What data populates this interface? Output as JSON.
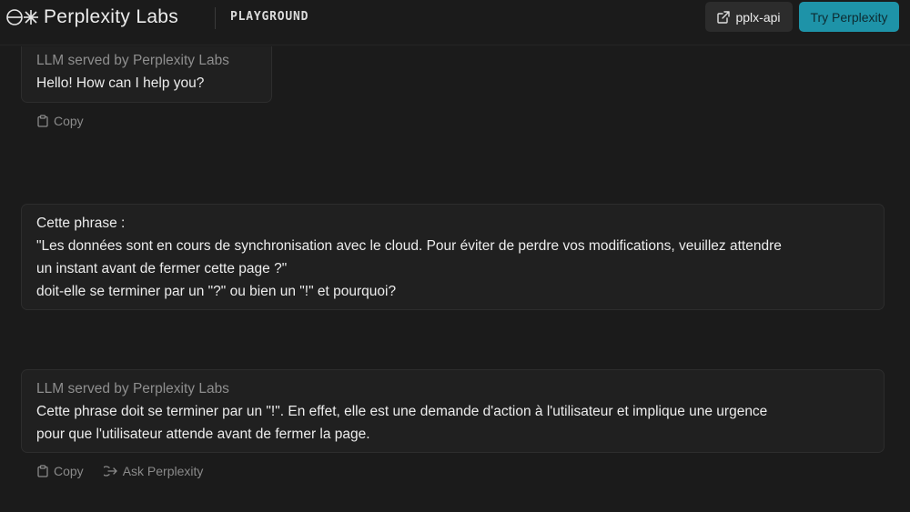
{
  "header": {
    "brand": "Perplexity Labs",
    "section": "PLAYGROUND",
    "api_label": "pplx-api",
    "try_label": "Try Perplexity"
  },
  "messages": [
    {
      "role": "assistant",
      "meta": "LLM served by Perplexity Labs",
      "lines": [
        "Hello! How can I help you?"
      ],
      "actions": [
        "Copy"
      ]
    },
    {
      "role": "user",
      "lines": [
        "Cette phrase :",
        "\"Les données sont en cours de synchronisation avec le cloud. Pour éviter de perdre vos modifications, veuillez attendre",
        "un instant avant de fermer cette page ?\"",
        "doit-elle se terminer par un \"?\" ou bien un \"!\" et pourquoi?"
      ]
    },
    {
      "role": "assistant",
      "meta": "LLM served by Perplexity Labs",
      "lines": [
        "Cette phrase doit se terminer par un \"!\". En effet, elle est une demande d'action à l'utilisateur et implique une urgence",
        "pour que l'utilisateur attende avant de fermer la page."
      ],
      "actions": [
        "Copy",
        "Ask Perplexity"
      ]
    }
  ],
  "icons": {
    "logo": "perplexity-logo-icon",
    "api": "external-link-icon",
    "copy": "clipboard-icon",
    "ask": "share-arrow-icon"
  },
  "colors": {
    "background": "#1b1b1b",
    "bubble": "#202020",
    "accent": "#1e93a8"
  }
}
